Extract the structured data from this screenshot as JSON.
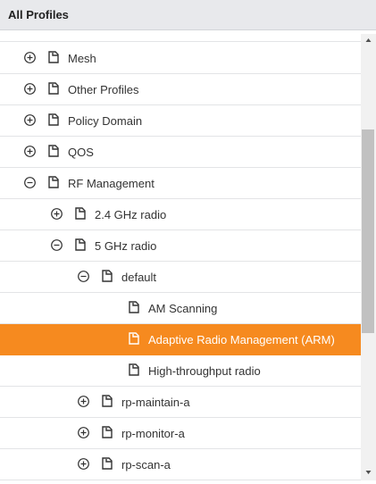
{
  "header": {
    "title": "All Profiles"
  },
  "tree": {
    "items": [
      {
        "label": "Mesh",
        "toggle": "expand"
      },
      {
        "label": "Other Profiles",
        "toggle": "expand"
      },
      {
        "label": "Policy Domain",
        "toggle": "expand"
      },
      {
        "label": "QOS",
        "toggle": "expand"
      },
      {
        "label": "RF Management",
        "toggle": "collapse"
      },
      {
        "label": "2.4 GHz radio",
        "toggle": "expand"
      },
      {
        "label": "5 GHz radio",
        "toggle": "collapse"
      },
      {
        "label": "default",
        "toggle": "collapse"
      },
      {
        "label": "AM Scanning",
        "toggle": "none"
      },
      {
        "label": "Adaptive Radio Management (ARM)",
        "toggle": "none",
        "selected": true
      },
      {
        "label": "High-throughput radio",
        "toggle": "none"
      },
      {
        "label": "rp-maintain-a",
        "toggle": "expand"
      },
      {
        "label": "rp-monitor-a",
        "toggle": "expand"
      },
      {
        "label": "rp-scan-a",
        "toggle": "expand"
      }
    ]
  },
  "colors": {
    "selected": "#f68a1f",
    "header_bg": "#e8e9ec"
  },
  "icons": {
    "expand": "plus-circle-icon",
    "collapse": "minus-circle-icon",
    "profile": "profile-document-icon"
  }
}
